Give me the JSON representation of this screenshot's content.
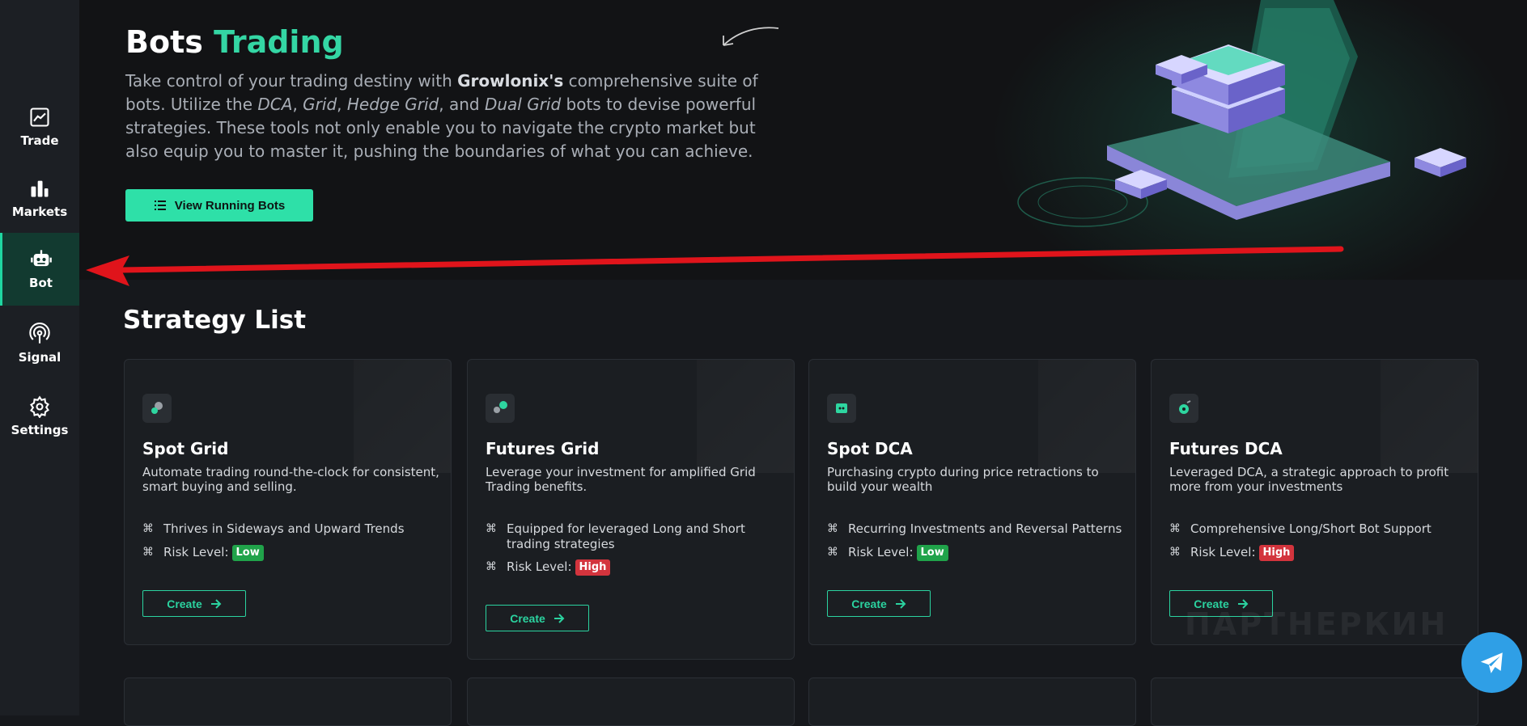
{
  "sidebar": {
    "items": [
      {
        "label": "Trade",
        "icon": "chart-line-icon"
      },
      {
        "label": "Markets",
        "icon": "bar-chart-icon"
      },
      {
        "label": "Bot",
        "icon": "robot-icon"
      },
      {
        "label": "Signal",
        "icon": "signal-icon"
      },
      {
        "label": "Settings",
        "icon": "gear-icon"
      }
    ],
    "active": "Bot"
  },
  "hero": {
    "title_main": "Bots",
    "title_accent": "Trading",
    "desc_p1": "Take control of your trading destiny with ",
    "desc_brand": "Growlonix's",
    "desc_p2": " comprehensive suite of bots. Utilize the ",
    "desc_dca": "DCA",
    "desc_sep1": ", ",
    "desc_grid": "Grid",
    "desc_sep2": ", ",
    "desc_hedge": "Hedge Grid",
    "desc_and": ", and ",
    "desc_dual": "Dual Grid",
    "desc_p3": " bots to devise powerful strategies. These tools not only enable you to navigate the crypto market but also equip you to master it, pushing the boundaries of what you can achieve.",
    "button_label": "View Running Bots"
  },
  "strategy": {
    "title": "Strategy List",
    "risk_label": "Risk Level:",
    "create_label": "Create",
    "cards": [
      {
        "title": "Spot Grid",
        "desc": "Automate trading round-the-clock for consistent, smart buying and selling.",
        "feature": "Thrives in Sideways and Upward Trends",
        "risk": "Low"
      },
      {
        "title": "Futures Grid",
        "desc": "Leverage your investment for amplified Grid Trading benefits.",
        "feature": "Equipped for leveraged Long and Short trading strategies",
        "risk": "High"
      },
      {
        "title": "Spot DCA",
        "desc": "Purchasing crypto during price retractions to build your wealth",
        "feature": "Recurring Investments and Reversal Patterns",
        "risk": "Low"
      },
      {
        "title": "Futures DCA",
        "desc": "Leveraged DCA, a strategic approach to profit more from your investments",
        "feature": "Comprehensive Long/Short Bot Support",
        "risk": "High"
      }
    ]
  },
  "watermark": "ПАРТНЕРКИН",
  "colors": {
    "accent": "#34d6a4",
    "low": "#20a34a",
    "high": "#d3343d",
    "annotation": "#e0141b",
    "telegram": "#2f9fe6"
  }
}
